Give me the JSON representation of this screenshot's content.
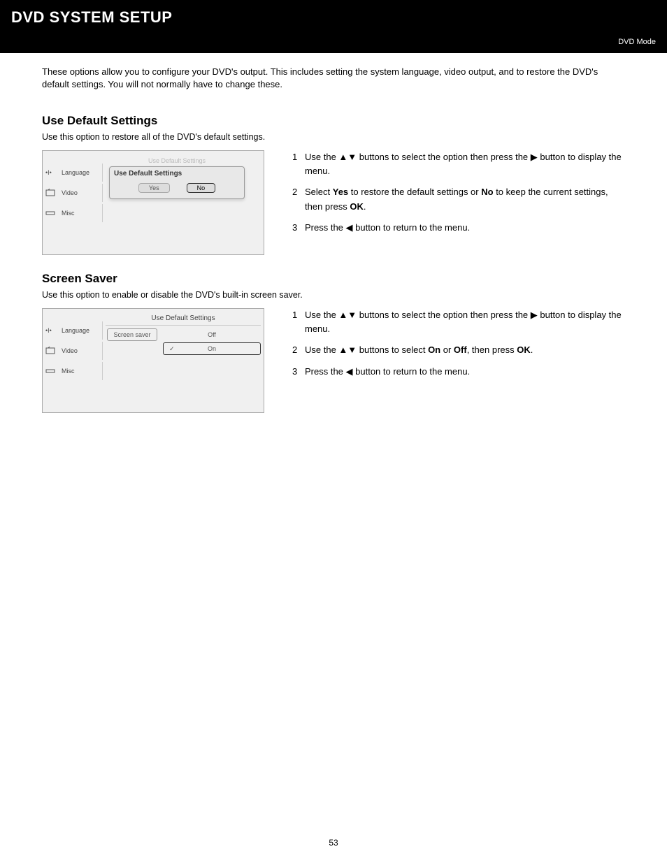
{
  "header": {
    "title": "DVD SYSTEM SETUP",
    "subtitle": "DVD Mode"
  },
  "intro": "These options allow you to configure your DVD's output. This includes setting the system language, video output, and to restore the DVD's default settings. You will not normally have to change these.",
  "section1": {
    "title": "Use Default Settings",
    "desc": "Use this option to restore all of the DVD's default settings.",
    "osd": {
      "sidebar": {
        "items": [
          "Language",
          "Video",
          "Misc"
        ]
      },
      "dialog": {
        "ghost_title": "Use Default Settings",
        "title": "Use Default Settings",
        "yes": "Yes",
        "no": "No"
      }
    },
    "steps": [
      {
        "num": "1",
        "body_pre": "Use the  ",
        "glyph": "▲▼",
        "body_mid": "  buttons to select the option then press the  ",
        "glyph2": "▶",
        "body_post": "  button to display the menu."
      },
      {
        "num": "2",
        "body_pre": "Select  ",
        "bold1": "Yes",
        "mid1": "  to restore the default settings or  ",
        "bold2": "No",
        "mid2": " to keep the current settings, then press  ",
        "bold3": "OK",
        "tail": "."
      },
      {
        "num": "3",
        "body_pre": "Press the  ",
        "glyph": "◀",
        "body_post": "  button to return to the menu."
      }
    ]
  },
  "section2": {
    "title": "Screen Saver",
    "desc": "Use this option to enable or disable the DVD's built-in screen saver.",
    "osd": {
      "sidebar": {
        "items": [
          "Language",
          "Video",
          "Misc"
        ]
      },
      "pane": {
        "heading": "Use Default Settings",
        "label": "Screen saver",
        "opt_off": "Off",
        "opt_on": "On"
      }
    },
    "steps": [
      {
        "num": "1",
        "body_pre": "Use the  ",
        "glyph": "▲▼",
        "body_mid": "  buttons to select the option then press the  ",
        "glyph2": "▶",
        "body_post": "  button to display the menu."
      },
      {
        "num": "2",
        "body_pre": "Use the  ",
        "glyph": "▲▼",
        "body_mid": "  buttons to select  ",
        "bold1": "On",
        "mid1": " or ",
        "bold2": "Off",
        "mid2": ", then press  ",
        "bold3": "OK",
        "tail": "."
      },
      {
        "num": "3",
        "body_pre": "Press the  ",
        "glyph": "◀",
        "body_post": "  button to return to the menu."
      }
    ]
  },
  "page_number": "53"
}
